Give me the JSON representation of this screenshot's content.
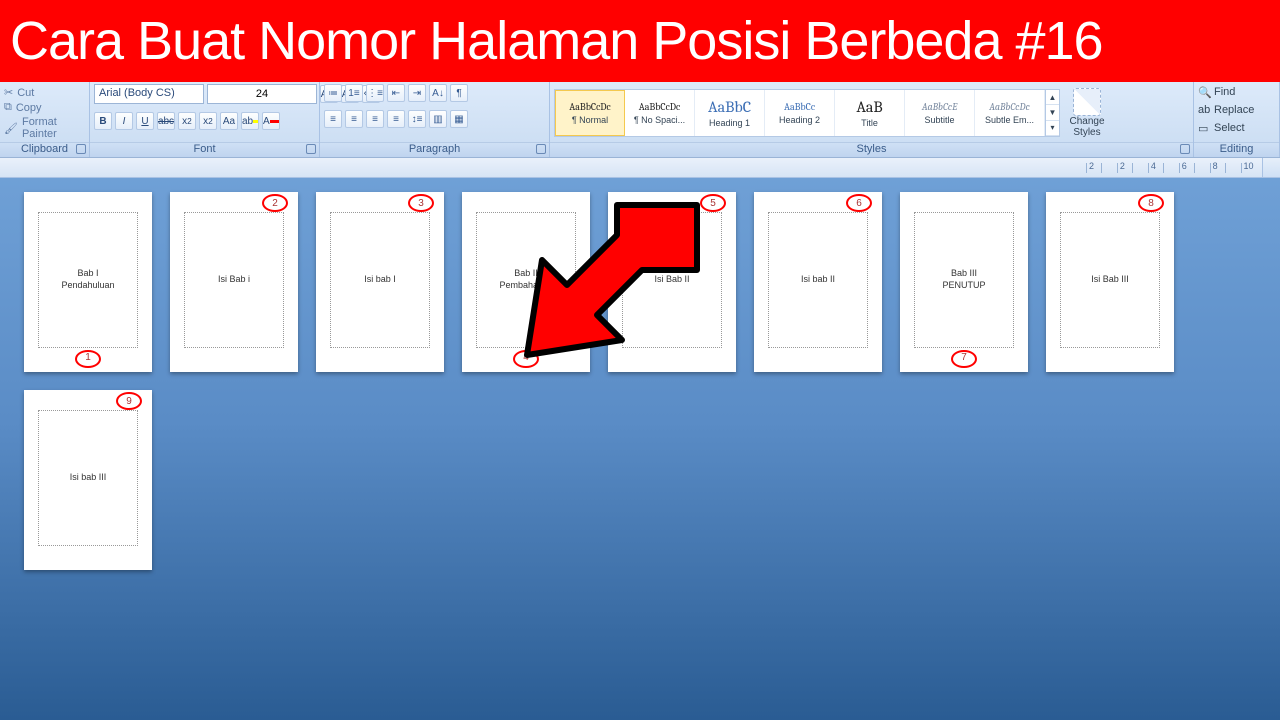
{
  "banner": {
    "title": "Cara Buat Nomor Halaman Posisi Berbeda #16"
  },
  "ribbon": {
    "clipboard": {
      "cut": "Cut",
      "copy": "Copy",
      "painter": "Format Painter",
      "label": "Clipboard"
    },
    "font": {
      "family": "Arial (Body CS)",
      "size": "24",
      "label": "Font",
      "bold": "B",
      "italic": "I",
      "underline": "U",
      "strike": "abc",
      "sub": "x₂",
      "sup": "x²",
      "case": "Aa"
    },
    "paragraph": {
      "label": "Paragraph"
    },
    "styles": {
      "label": "Styles",
      "items": [
        {
          "sample": "AaBbCcDc",
          "name": "¶ Normal",
          "cls": "samp",
          "sel": true
        },
        {
          "sample": "AaBbCcDc",
          "name": "¶ No Spaci...",
          "cls": "samp",
          "sel": false
        },
        {
          "sample": "AaBbC",
          "name": "Heading 1",
          "cls": "samp blue big",
          "sel": false
        },
        {
          "sample": "AaBbCc",
          "name": "Heading 2",
          "cls": "samp blue",
          "sel": false
        },
        {
          "sample": "AaB",
          "name": "Title",
          "cls": "samp big",
          "sel": false
        },
        {
          "sample": "AaBbCcE",
          "name": "Subtitle",
          "cls": "samp grey",
          "sel": false
        },
        {
          "sample": "AaBbCcDc",
          "name": "Subtle Em...",
          "cls": "samp grey",
          "sel": false
        }
      ],
      "change": "Change Styles"
    },
    "editing": {
      "find": "Find",
      "replace": "Replace",
      "select": "Select",
      "label": "Editing"
    }
  },
  "ruler": {
    "marks": [
      "2",
      "",
      "2",
      "",
      "4",
      "",
      "6",
      "",
      "8",
      "",
      "10"
    ]
  },
  "pages": [
    {
      "text": "Bab I\nPendahuluan",
      "num": "1",
      "pos": "bottom"
    },
    {
      "text": "Isi Bab i",
      "num": "2",
      "pos": "top"
    },
    {
      "text": "Isi bab I",
      "num": "3",
      "pos": "top"
    },
    {
      "text": "Bab II\nPembahasan",
      "num": "4",
      "pos": "bottom"
    },
    {
      "text": "Isi Bab II",
      "num": "5",
      "pos": "top"
    },
    {
      "text": "Isi bab II",
      "num": "6",
      "pos": "top"
    },
    {
      "text": "Bab III\nPENUTUP",
      "num": "7",
      "pos": "bottom"
    },
    {
      "text": "Isi Bab III",
      "num": "8",
      "pos": "top"
    },
    {
      "text": "Isi bab III",
      "num": "9",
      "pos": "top"
    }
  ]
}
